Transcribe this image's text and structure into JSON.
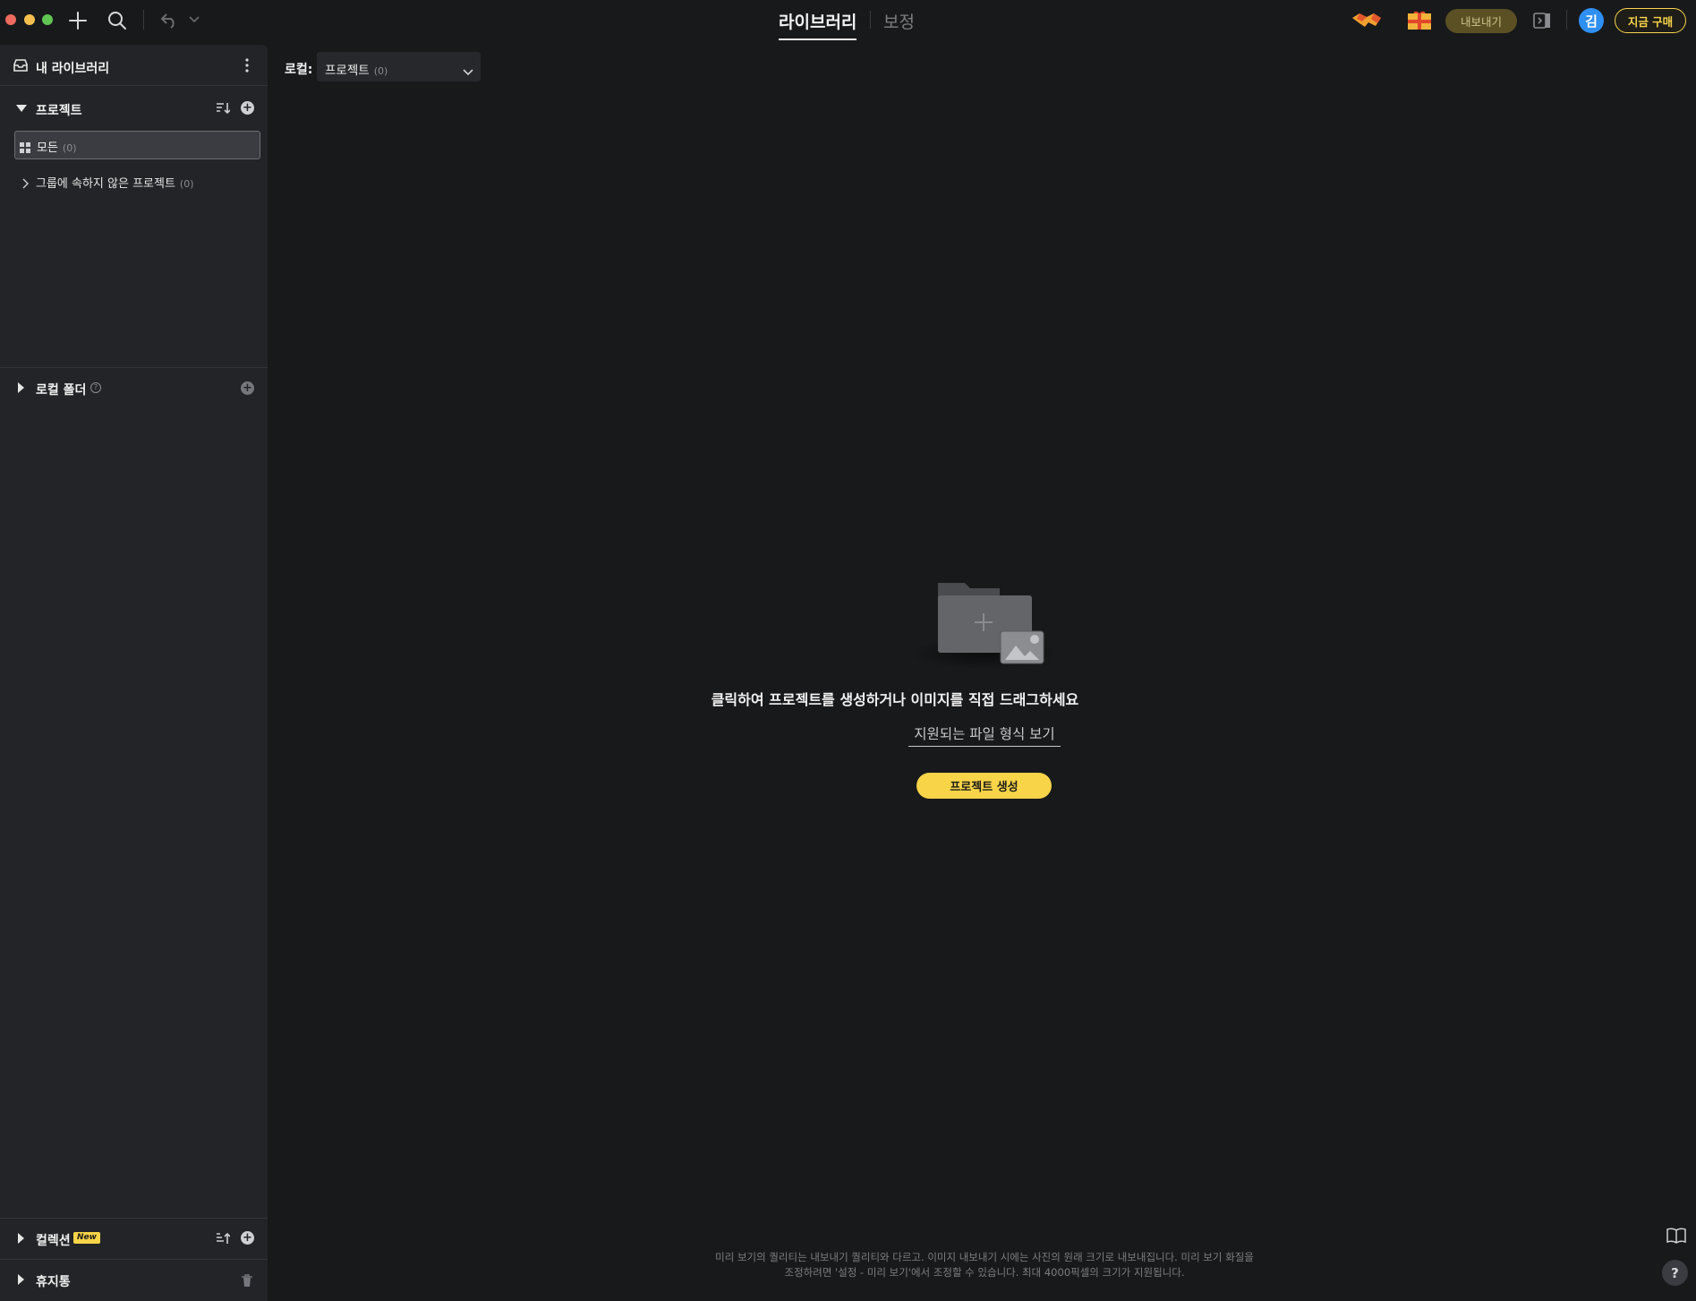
{
  "topbar": {
    "tabs": [
      {
        "label": "라이브러리",
        "active": true
      },
      {
        "label": "보정",
        "active": false
      }
    ],
    "export_label": "내보내기",
    "avatar_initial": "김",
    "buy_label": "지금 구매"
  },
  "sidebar": {
    "title": "내 라이브러리",
    "projects": {
      "title": "프로젝트",
      "all_label": "모든",
      "all_count": "(0)",
      "ungrouped_label": "그룹에 속하지 않은 프로젝트",
      "ungrouped_count": "(0)"
    },
    "local_folder": {
      "title": "로컬 폴더",
      "help": "?"
    },
    "collection": {
      "title": "컬렉션",
      "badge": "New"
    },
    "trash": {
      "title": "휴지통"
    }
  },
  "main": {
    "filter_label": "로컬:",
    "filter_value": "프로젝트",
    "filter_count": "(0)",
    "empty_title": "클릭하여 프로젝트를 생성하거나 이미지를 직접 드래그하세요",
    "formats_link": "지원되는 파일 형식 보기",
    "create_button": "프로젝트 생성",
    "footnote_line1": "미리 보기의 퀄리티는 내보내기 퀄리티와 다르고. 이미지 내보내기 시에는 사진의 원래 크기로 내보내집니다. 미리 보기 화질을",
    "footnote_line2": "조정하려면 '설정 - 미리 보기'에서 조정할 수 있습니다. 최대 4000픽셀의 크기가 지원됩니다.",
    "help_label": "?"
  },
  "colors": {
    "accent": "#f7d448",
    "background": "#18191b",
    "sidebar": "#222427",
    "avatar": "#2f8ff2"
  }
}
